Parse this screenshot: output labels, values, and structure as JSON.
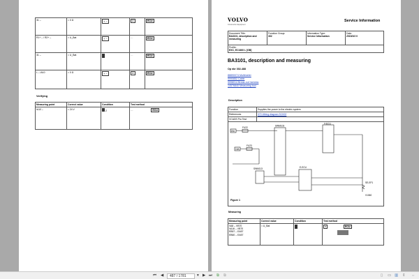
{
  "left_page": {
    "rows": [
      {
        "point": "31 –",
        "value": "= 0 Ω",
        "condition": "battery-disconnected",
        "method": "ohm"
      },
      {
        "point": "R1+ – / R2+ –",
        "value": "= U_Bat",
        "condition": "battery-disconnected",
        "method": "—"
      },
      {
        "point": "31 –",
        "value": "= U_Bat",
        "condition": "key-on",
        "method": "—"
      },
      {
        "point": "L – IA10",
        "value": "= 0 Ω",
        "condition": "battery-disconnected",
        "method": "ohm"
      }
    ],
    "ecu_label": "ECU",
    "verifying_heading": "Verifying",
    "verify_headers": [
      "Measuring point",
      "Correct value",
      "Condition",
      "Test method"
    ],
    "verify_row": {
      "point": "IA10 –",
      "value": "≈ 24 V",
      "condition_num": "2",
      "method": "—"
    }
  },
  "right_page": {
    "logo": "VOLVO",
    "logo_sub": "Construction Equipment",
    "header_title": "Service Information",
    "doc_table": {
      "doc_title_label": "Document Title:",
      "doc_title": "BA3101, description and measuring",
      "function_group_label": "Function Group:",
      "function_group": "302",
      "info_type_label": "Information Type:",
      "info_type": "Service Information",
      "date_label": "Date:",
      "date": "2015/2/2 0",
      "profile_label": "Profile:",
      "profile": "EXC, EC1600 L [GB]"
    },
    "title": "BA3101, description and measuring",
    "op_nbr": "Op nbr 302-488",
    "links": [
      "88890074 Multimeter",
      "9990852 Cable",
      "9998014 Break-out harness",
      "14576840 Measuring tool"
    ],
    "description_heading": "Description",
    "desc_rows": [
      {
        "label": "Function",
        "value": "Supplies the power to the electric system"
      },
      {
        "label": "References",
        "value": "370 Wiring diagram SCH02"
      },
      {
        "label": "VCADS Pro Test",
        "value": ""
      }
    ],
    "schematic_labels": {
      "swm103": "SWM103",
      "vecu": "V-ECU",
      "fu22": "FU22",
      "fu23": "FU23",
      "fuse_a": "15A",
      "fuse_b": "15A",
      "swm113": "SWM113",
      "eecu": "E-ECU",
      "se": "SE-EF1",
      "ref": "V1060"
    },
    "figure_caption": "Figure 1",
    "measuring_heading": "Measuring",
    "measure_headers": [
      "Measuring point",
      "Correct value",
      "Condition",
      "Test method"
    ],
    "measure_points": [
      "VA8 – VB70",
      "VA16 – VB70",
      "EB57 – EA57",
      "EB60 – EA57"
    ],
    "measure_value": "= U_Bat",
    "ecu_label": "ECU"
  },
  "toolbar": {
    "page_indicator": "487 / 1781"
  }
}
